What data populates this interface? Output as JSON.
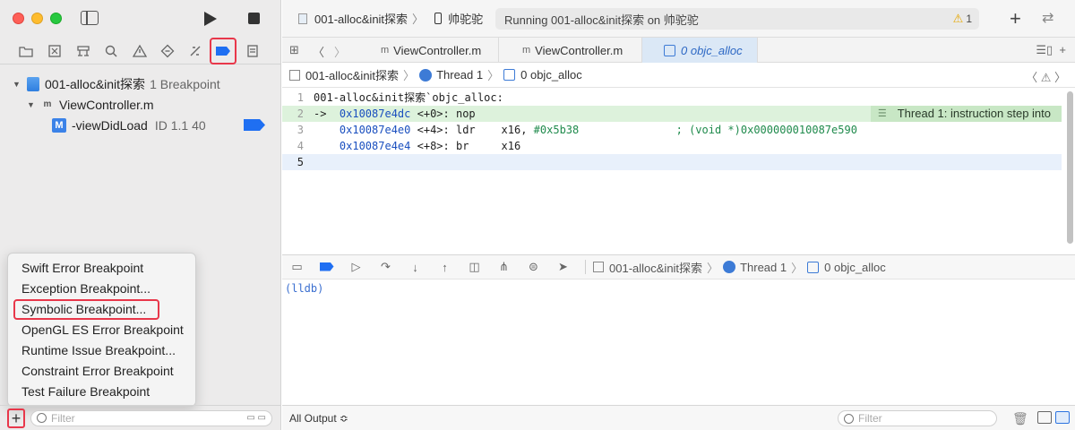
{
  "sidebar": {
    "tree": {
      "project_name": "001-alloc&init探索",
      "project_count": "1 Breakpoint",
      "file_name": "ViewController.m",
      "breakpoint_name": "-viewDidLoad",
      "breakpoint_detail": "ID 1.1 40"
    },
    "menu": [
      "Swift Error Breakpoint",
      "Exception Breakpoint...",
      "Symbolic Breakpoint...",
      "OpenGL ES Error Breakpoint",
      "Runtime Issue Breakpoint...",
      "Constraint Error Breakpoint",
      "Test Failure Breakpoint"
    ],
    "filter_placeholder": "Filter",
    "add_label": "+"
  },
  "toolbar": {
    "scheme": "001-alloc&init探索",
    "device": "帅驼驼",
    "status": "Running 001-alloc&init探索 on 帅驼驼",
    "warning_count": "1"
  },
  "tabs": [
    {
      "label": "ViewController.m",
      "icon": "m-file-icon"
    },
    {
      "label": "ViewController.m",
      "icon": "m-file-icon"
    },
    {
      "label": "0 objc_alloc",
      "icon": "frame-icon",
      "active": true
    }
  ],
  "jumpbar": {
    "project": "001-alloc&init探索",
    "thread": "Thread 1",
    "frame": "0 objc_alloc"
  },
  "code": {
    "lines": [
      {
        "num": "1",
        "parts": [
          {
            "t": "001-alloc&init探索`objc_alloc:",
            "c": ""
          }
        ]
      },
      {
        "num": "2",
        "parts": [
          {
            "t": "->  ",
            "c": ""
          },
          {
            "t": "0x10087e4dc",
            "c": "addr"
          },
          {
            "t": " <+0>: nop",
            "c": ""
          }
        ]
      },
      {
        "num": "3",
        "parts": [
          {
            "t": "    ",
            "c": ""
          },
          {
            "t": "0x10087e4e0",
            "c": "addr"
          },
          {
            "t": " <+4>: ldr    x16, ",
            "c": ""
          },
          {
            "t": "#0x5b38",
            "c": "imm"
          },
          {
            "t": "               ",
            "c": ""
          },
          {
            "t": "; (void *)0x000000010087e590",
            "c": "cmt"
          }
        ]
      },
      {
        "num": "4",
        "parts": [
          {
            "t": "    ",
            "c": ""
          },
          {
            "t": "0x10087e4e4",
            "c": "addr"
          },
          {
            "t": " <+8>: br     x16",
            "c": ""
          }
        ]
      },
      {
        "num": "5",
        "parts": [
          {
            "t": "",
            "c": ""
          }
        ]
      }
    ],
    "badge": "Thread 1: instruction step into"
  },
  "debugbar": {
    "project": "001-alloc&init探索",
    "thread": "Thread 1",
    "frame": "0 objc_alloc"
  },
  "console": {
    "prompt": "(lldb)"
  },
  "bottom": {
    "output_select": "All Output ≎",
    "filter_placeholder": "Filter"
  },
  "colors": {
    "accent": "#1f6ff2",
    "highlight_red": "#e8374a",
    "exec_line": "#ddf2dc"
  }
}
